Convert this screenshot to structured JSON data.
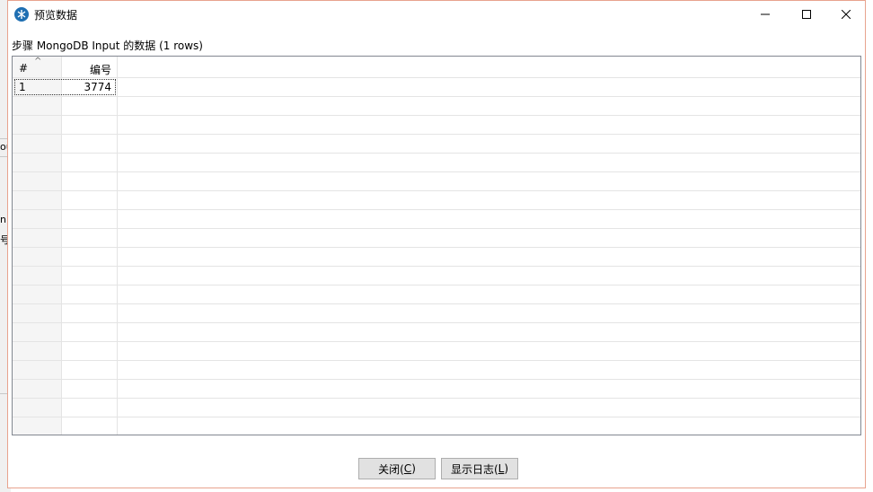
{
  "window": {
    "title": "预览数据"
  },
  "step_label": "步骤 MongoDB Input 的数据  (1 rows)",
  "table": {
    "headers": [
      "#",
      "编号"
    ],
    "rows": [
      {
        "index": "1",
        "value": "3774"
      }
    ]
  },
  "buttons": {
    "close_prefix": "关闭(",
    "close_key": "C",
    "close_suffix": ")",
    "log_prefix": "显示日志(",
    "log_key": "L",
    "log_suffix": ")"
  },
  "background_window": {
    "fragment_1": "ou",
    "fragment_2": "n",
    "fragment_3": "号"
  },
  "colors": {
    "border_accent": "#e8a38e",
    "app_icon": "#1f6fb2",
    "grid_border": "#828790",
    "button_bg": "#e1e1e1"
  }
}
